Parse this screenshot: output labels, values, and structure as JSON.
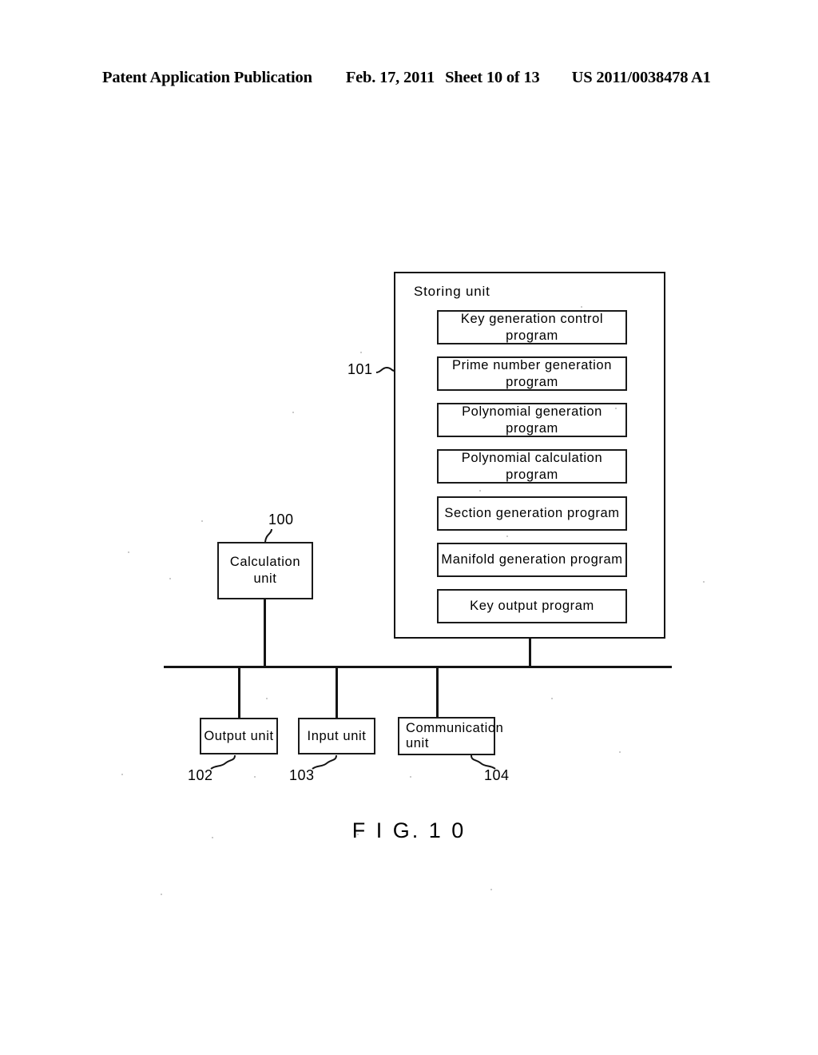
{
  "header": {
    "title": "Patent Application Publication",
    "date": "Feb. 17, 2011",
    "sheet": "Sheet 10 of 13",
    "publication_number": "US 2011/0038478 A1"
  },
  "figure": {
    "caption": "F I G. 1 0"
  },
  "diagram": {
    "storing_unit": {
      "label": "Storing unit",
      "ref": "101",
      "programs": [
        {
          "label": "Key generation control program"
        },
        {
          "label": "Prime number generation program"
        },
        {
          "label": "Polynomial generation program"
        },
        {
          "label": "Polynomial calculation program"
        },
        {
          "label": "Section generation program"
        },
        {
          "label": "Manifold generation program"
        },
        {
          "label": "Key output program"
        }
      ]
    },
    "calculation_unit": {
      "label": "Calculation unit",
      "ref": "100"
    },
    "output_unit": {
      "label": "Output unit",
      "ref": "102"
    },
    "input_unit": {
      "label": "Input unit",
      "ref": "103"
    },
    "communication_unit": {
      "label_line1": "Communication",
      "label_line2": "unit",
      "ref": "104"
    }
  },
  "colors": {
    "ink": "#141414",
    "paper": "#ffffff"
  }
}
